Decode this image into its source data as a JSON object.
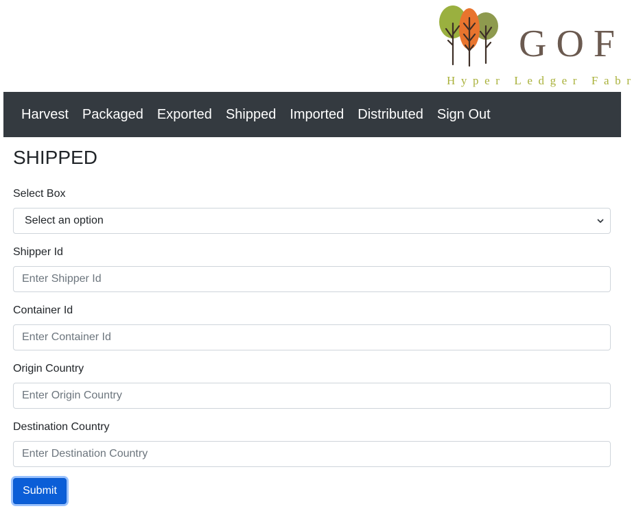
{
  "logo": {
    "title": "GOF",
    "subtitle": "Hyper Ledger Fabric",
    "colors": {
      "tree_left": "#9ab03f",
      "tree_mid": "#e8742e",
      "tree_right": "#8e9a4e",
      "trunk": "#3d2e26"
    }
  },
  "nav": {
    "items": [
      "Harvest",
      "Packaged",
      "Exported",
      "Shipped",
      "Imported",
      "Distributed",
      "Sign Out"
    ],
    "background": "#343a40"
  },
  "page": {
    "title": "SHIPPED"
  },
  "form": {
    "select_box": {
      "label": "Select Box",
      "value": "Select an option"
    },
    "shipper_id": {
      "label": "Shipper Id",
      "placeholder": "Enter Shipper Id"
    },
    "container_id": {
      "label": "Container Id",
      "placeholder": "Enter Container Id"
    },
    "origin_country": {
      "label": "Origin Country",
      "placeholder": "Enter Origin Country"
    },
    "destination_country": {
      "label": "Destination Country",
      "placeholder": "Enter Destination Country"
    },
    "submit_label": "Submit",
    "accent": "#0b5ed7"
  }
}
